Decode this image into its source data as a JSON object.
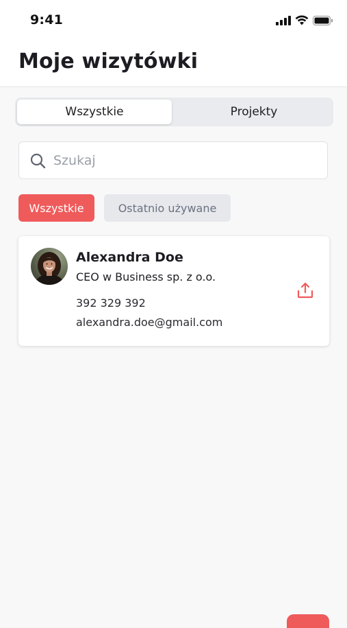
{
  "status_bar": {
    "time": "9:41",
    "icons": [
      "signal-icon",
      "wifi-icon",
      "battery-icon"
    ]
  },
  "header": {
    "title": "Moje wizytówki"
  },
  "tabs": [
    {
      "label": "Wszystkie",
      "active": true
    },
    {
      "label": "Projekty",
      "active": false
    }
  ],
  "search": {
    "placeholder": "Szukaj",
    "value": "",
    "icon": "search-icon"
  },
  "filters": [
    {
      "label": "Wszystkie",
      "active": true
    },
    {
      "label": "Ostatnio używane",
      "active": false
    }
  ],
  "cards": [
    {
      "name": "Alexandra Doe",
      "title": "CEO w Business sp. z o.o.",
      "phone": "392 329 392",
      "email": "alexandra.doe@gmail.com",
      "avatar": "avatar-photo",
      "action_icon": "share-icon"
    }
  ],
  "colors": {
    "accent": "#ef5b5b",
    "background": "#f8f8f9",
    "chip_inactive": "#e6e8ec",
    "segment_bg": "#e9ebee"
  }
}
